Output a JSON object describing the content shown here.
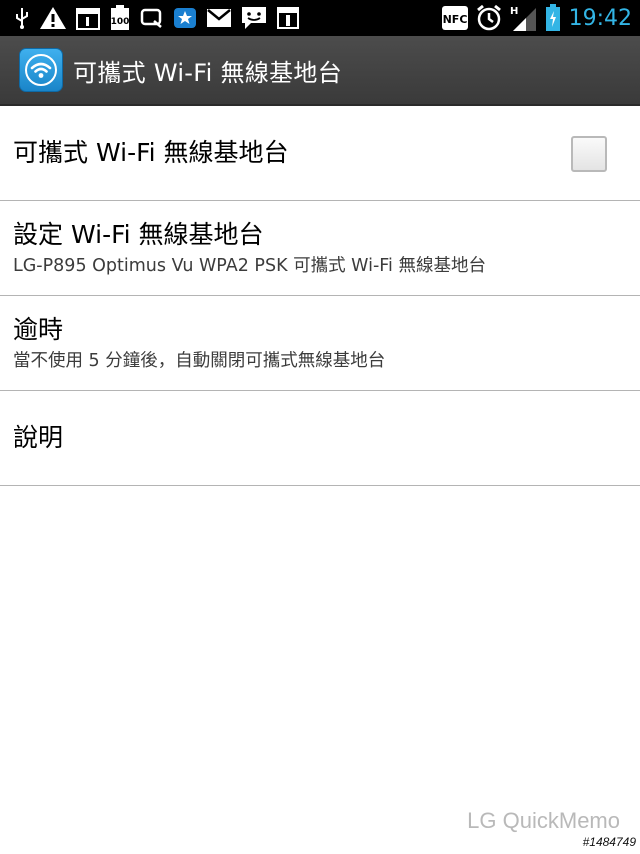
{
  "status_bar": {
    "time": "19:42",
    "battery_level_label": "100",
    "nfc_label": "NFC",
    "network_label": "H",
    "time_color": "#33b5e5",
    "left_icons": [
      "usb-icon",
      "warning-icon",
      "calendar-icon",
      "battery-100-icon",
      "quickmemo-icon",
      "app-store-icon",
      "gmail-icon",
      "messaging-icon",
      "download-icon"
    ],
    "right_icons": [
      "nfc-icon",
      "alarm-icon",
      "signal-icon",
      "battery-icon"
    ]
  },
  "action_bar": {
    "title": "可攜式 Wi-Fi 無線基地台",
    "icon": "wifi-hotspot-icon",
    "accent_color": "#2a9ae0"
  },
  "preferences": {
    "hotspot_toggle": {
      "title": "可攜式 Wi-Fi 無線基地台",
      "checked": false
    },
    "configure": {
      "title": "設定 Wi-Fi 無線基地台",
      "summary": "LG-P895 Optimus Vu WPA2 PSK 可攜式 Wi-Fi 無線基地台"
    },
    "timeout": {
      "title": "逾時",
      "summary": "當不使用 5 分鐘後，自動關閉可攜式無線基地台"
    },
    "help": {
      "title": "說明"
    }
  },
  "watermark": "LG QuickMemo",
  "image_id": "#1484749"
}
